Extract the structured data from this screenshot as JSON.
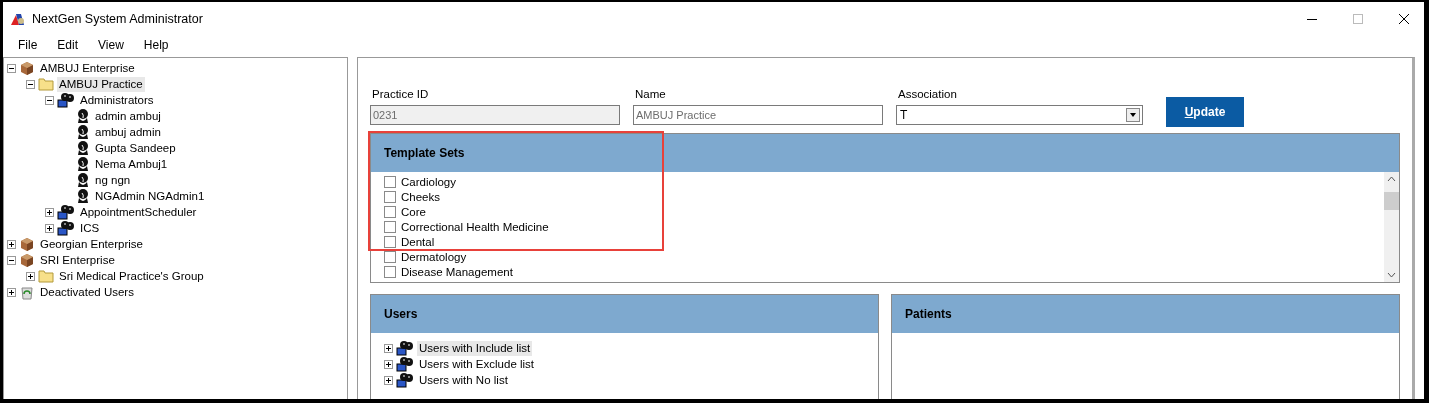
{
  "window": {
    "title": "NextGen System Administrator"
  },
  "menu": [
    "File",
    "Edit",
    "View",
    "Help"
  ],
  "tree": [
    {
      "label": "AMBUJ Enterprise",
      "kind": "enterprise",
      "expanded": true,
      "selected": false,
      "children": [
        {
          "label": "AMBUJ Practice",
          "kind": "folder",
          "expanded": true,
          "selected": true,
          "children": [
            {
              "label": "Administrators",
              "kind": "group",
              "expanded": true,
              "selected": false,
              "children": [
                {
                  "label": "admin ambuj",
                  "kind": "user",
                  "selected": false
                },
                {
                  "label": "ambuj admin",
                  "kind": "user",
                  "selected": false
                },
                {
                  "label": "Gupta Sandeep",
                  "kind": "user",
                  "selected": false
                },
                {
                  "label": "Nema Ambuj1",
                  "kind": "user",
                  "selected": false
                },
                {
                  "label": "ng ngn",
                  "kind": "user",
                  "selected": false
                },
                {
                  "label": "NGAdmin NGAdmin1",
                  "kind": "user",
                  "selected": false
                }
              ]
            },
            {
              "label": "AppointmentScheduler",
              "kind": "group",
              "expanded": false,
              "selected": false
            },
            {
              "label": "ICS",
              "kind": "group",
              "expanded": false,
              "selected": false
            }
          ]
        }
      ]
    },
    {
      "label": "Georgian Enterprise",
      "kind": "enterprise",
      "expanded": false,
      "selected": false
    },
    {
      "label": "SRI Enterprise",
      "kind": "enterprise",
      "expanded": true,
      "selected": false,
      "children": [
        {
          "label": "Sri Medical Practice's Group",
          "kind": "folder",
          "expanded": false,
          "selected": false
        }
      ]
    },
    {
      "label": "Deactivated Users",
      "kind": "deactivated",
      "expanded": false,
      "selected": false
    }
  ],
  "practice": {
    "practice_id_label": "Practice ID",
    "practice_id": "0231",
    "name_label": "Name",
    "name": "AMBUJ Practice",
    "association_label": "Association",
    "association": "T",
    "update_button": "Update"
  },
  "template_sets": {
    "title": "Template Sets",
    "items": [
      {
        "label": "Cardiology",
        "checked": false
      },
      {
        "label": "Cheeks",
        "checked": false
      },
      {
        "label": "Core",
        "checked": false
      },
      {
        "label": "Correctional Health Medicine",
        "checked": false
      },
      {
        "label": "Dental",
        "checked": false
      },
      {
        "label": "Dermatology",
        "checked": false
      },
      {
        "label": "Disease Management",
        "checked": false
      }
    ]
  },
  "users": {
    "title": "Users",
    "items": [
      {
        "label": "Users with Include list",
        "expanded": false,
        "selected": true
      },
      {
        "label": "Users with Exclude list",
        "expanded": false,
        "selected": false
      },
      {
        "label": "Users with No list",
        "expanded": false,
        "selected": false
      }
    ]
  },
  "patients": {
    "title": "Patients"
  }
}
